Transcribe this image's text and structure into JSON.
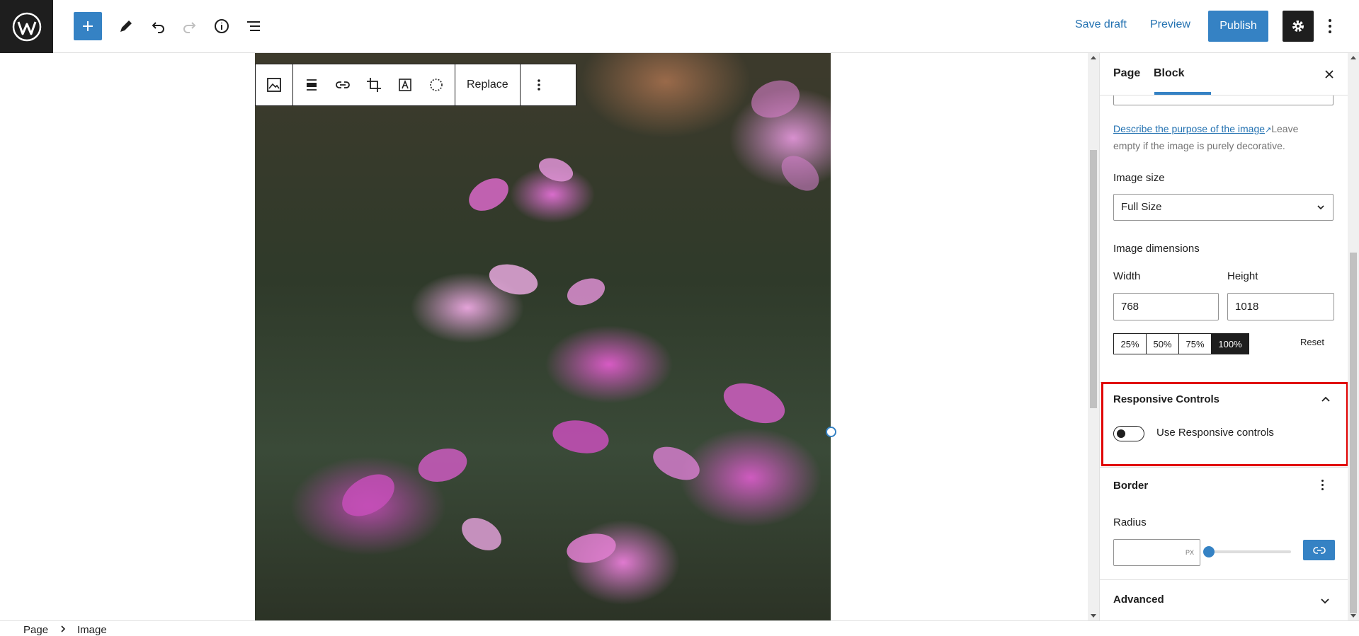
{
  "topbar": {
    "save_draft": "Save draft",
    "preview": "Preview",
    "publish": "Publish"
  },
  "image_toolbar": {
    "replace": "Replace"
  },
  "sidebar": {
    "tabs": [
      {
        "label": "Page"
      },
      {
        "label": "Block",
        "active": true
      }
    ],
    "alt_help_link": "Describe the purpose of the image",
    "alt_help_rest": "Leave empty if the image is purely decorative.",
    "image_size_label": "Image size",
    "image_size_value": "Full Size",
    "dimensions_label": "Image dimensions",
    "width_label": "Width",
    "width_value": "768",
    "height_label": "Height",
    "height_value": "1018",
    "percent_options": [
      "25%",
      "50%",
      "75%",
      "100%"
    ],
    "percent_selected": "100%",
    "reset": "Reset",
    "responsive_title": "Responsive Controls",
    "responsive_toggle_label": "Use Responsive controls",
    "responsive_toggle_on": false,
    "border_title": "Border",
    "radius_label": "Radius",
    "radius_unit": "PX",
    "radius_value": 0,
    "advanced_title": "Advanced"
  },
  "breadcrumb": {
    "items": [
      "Page",
      "Image"
    ]
  },
  "colors": {
    "accent": "#3582c4",
    "dark": "#1e1e1e",
    "highlight": "#e00000"
  }
}
